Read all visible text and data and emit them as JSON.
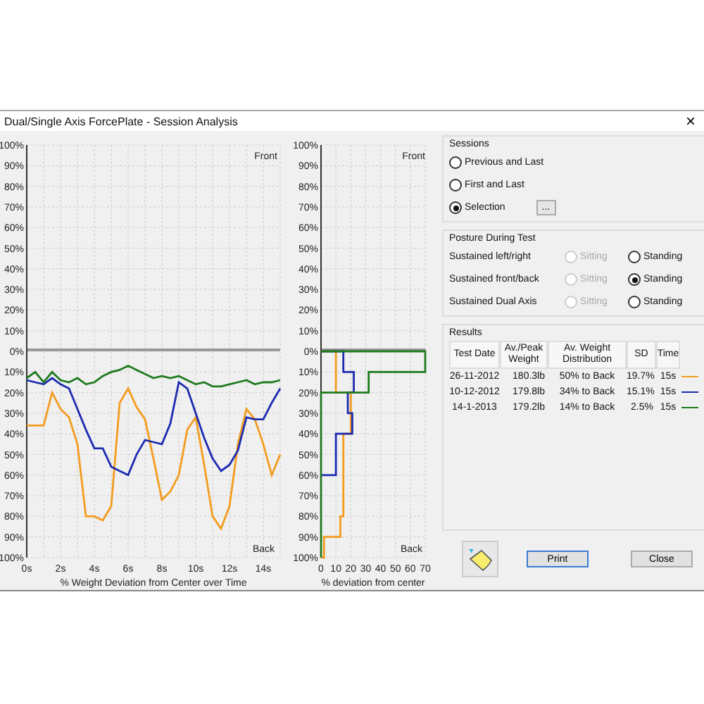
{
  "window": {
    "title": "Dual/Single Axis ForcePlate - Session Analysis",
    "close": "×"
  },
  "time_chart": {
    "top_label": "Front",
    "bottom_label": "Back",
    "chart_data": {
      "type": "line",
      "grid": true,
      "xlabel": "% Weight Deviation from Center over Time",
      "xlim": [
        0,
        15
      ],
      "ylim": [
        -100,
        100
      ],
      "x": [
        0,
        0.5,
        1,
        1.5,
        2,
        2.5,
        3,
        3.5,
        4,
        4.5,
        5,
        5.5,
        6,
        6.5,
        7,
        7.5,
        8,
        8.5,
        9,
        9.5,
        10,
        10.5,
        11,
        11.5,
        12,
        12.5,
        13,
        13.5,
        14,
        14.5,
        15
      ],
      "series": [
        {
          "color": "#f39c1f",
          "values": [
            -36,
            -36,
            -36,
            -20,
            -28,
            -32,
            -45,
            -80,
            -80,
            -82,
            -75,
            -25,
            -18,
            -27,
            -33,
            -52,
            -72,
            -68,
            -60,
            -38,
            -32,
            -55,
            -80,
            -86,
            -75,
            -45,
            -28,
            -33,
            -45,
            -60,
            -50
          ]
        },
        {
          "color": "#1c2bb0",
          "values": [
            -14,
            -15,
            -16,
            -13,
            -16,
            -18,
            -28,
            -38,
            -47,
            -47,
            -56,
            -58,
            -60,
            -50,
            -43,
            -44,
            -45,
            -35,
            -15,
            -18,
            -30,
            -42,
            -52,
            -58,
            -55,
            -48,
            -32,
            -33,
            -33,
            -25,
            -18
          ]
        },
        {
          "color": "#1f7a1f",
          "values": [
            -13,
            -10,
            -15,
            -10,
            -14,
            -15,
            -13,
            -16,
            -15,
            -12,
            -10,
            -9,
            -7,
            -9,
            -11,
            -13,
            -12,
            -13,
            -12,
            -14,
            -16,
            -15,
            -17,
            -17,
            -16,
            -15,
            -14,
            -16,
            -15,
            -15,
            -14
          ]
        }
      ],
      "xticks": [
        {
          "value": 0,
          "label": "0s"
        },
        {
          "value": 2,
          "label": "2s"
        },
        {
          "value": 4,
          "label": "4s"
        },
        {
          "value": 6,
          "label": "6s"
        },
        {
          "value": 8,
          "label": "8s"
        },
        {
          "value": 10,
          "label": "10s"
        },
        {
          "value": 12,
          "label": "12s"
        },
        {
          "value": 14,
          "label": "14s"
        }
      ],
      "yticks": [
        {
          "value": 100,
          "label": "100%"
        },
        {
          "value": 90,
          "label": "90%"
        },
        {
          "value": 80,
          "label": "80%"
        },
        {
          "value": 70,
          "label": "70%"
        },
        {
          "value": 60,
          "label": "60%"
        },
        {
          "value": 50,
          "label": "50%"
        },
        {
          "value": 40,
          "label": "40%"
        },
        {
          "value": 30,
          "label": "30%"
        },
        {
          "value": 20,
          "label": "20%"
        },
        {
          "value": 10,
          "label": "10%"
        },
        {
          "value": 0,
          "label": "0%"
        },
        {
          "value": -10,
          "label": "10%"
        },
        {
          "value": -20,
          "label": "20%"
        },
        {
          "value": -30,
          "label": "30%"
        },
        {
          "value": -40,
          "label": "40%"
        },
        {
          "value": -50,
          "label": "50%"
        },
        {
          "value": -60,
          "label": "60%"
        },
        {
          "value": -70,
          "label": "70%"
        },
        {
          "value": -80,
          "label": "80%"
        },
        {
          "value": -90,
          "label": "90%"
        },
        {
          "value": -100,
          "label": "100%"
        }
      ]
    }
  },
  "deviation_chart": {
    "top_label": "Front",
    "bottom_label": "Back",
    "chart_data": {
      "type": "line",
      "grid": true,
      "orientation": "horizontal",
      "xlabel": "% deviation from center",
      "xlim": [
        0,
        70
      ],
      "ylim": [
        -100,
        100
      ],
      "x": [
        0,
        0,
        -10,
        -10,
        -20,
        -20,
        -30,
        -30,
        -40,
        -40,
        -50,
        -50,
        -60,
        -60,
        -70,
        -70,
        -80,
        -80,
        -90,
        -90,
        -100,
        -100
      ],
      "series": [
        {
          "color": "#f39c1f",
          "values": [
            0,
            10,
            10,
            10,
            10,
            20,
            20,
            20,
            20,
            15,
            15,
            15,
            15,
            15,
            15,
            15,
            15,
            13,
            13,
            2,
            2,
            0
          ]
        },
        {
          "color": "#1c2bb0",
          "values": [
            0,
            15,
            15,
            22,
            22,
            18,
            18,
            21,
            21,
            10,
            10,
            10,
            10,
            0,
            null,
            null,
            null,
            null,
            null,
            null,
            null,
            null
          ]
        },
        {
          "color": "#1f7a1f",
          "values": [
            0,
            70,
            70,
            32,
            32,
            0,
            0,
            0,
            0,
            0,
            0,
            0,
            0,
            0,
            0,
            0,
            0,
            0,
            0,
            0,
            0,
            0
          ]
        }
      ],
      "xticks": [
        0,
        10,
        20,
        30,
        40,
        50,
        60,
        70
      ],
      "yticks": [
        {
          "value": 100,
          "label": "100%"
        },
        {
          "value": 90,
          "label": "90%"
        },
        {
          "value": 80,
          "label": "80%"
        },
        {
          "value": 70,
          "label": "70%"
        },
        {
          "value": 60,
          "label": "60%"
        },
        {
          "value": 50,
          "label": "50%"
        },
        {
          "value": 40,
          "label": "40%"
        },
        {
          "value": 30,
          "label": "30%"
        },
        {
          "value": 20,
          "label": "20%"
        },
        {
          "value": 10,
          "label": "10%"
        },
        {
          "value": 0,
          "label": "0%"
        },
        {
          "value": -10,
          "label": "10%"
        },
        {
          "value": -20,
          "label": "20%"
        },
        {
          "value": -30,
          "label": "30%"
        },
        {
          "value": -40,
          "label": "40%"
        },
        {
          "value": -50,
          "label": "50%"
        },
        {
          "value": -60,
          "label": "60%"
        },
        {
          "value": -70,
          "label": "70%"
        },
        {
          "value": -80,
          "label": "80%"
        },
        {
          "value": -90,
          "label": "90%"
        },
        {
          "value": -100,
          "label": "100%"
        }
      ]
    }
  },
  "sessions": {
    "title": "Sessions",
    "options": [
      {
        "label": "Previous and Last",
        "selected": false
      },
      {
        "label": "First and Last",
        "selected": false
      },
      {
        "label": "Selection",
        "selected": true
      }
    ],
    "browse_button": "..."
  },
  "posture": {
    "title": "Posture During Test",
    "rows": [
      {
        "label": "Sustained left/right",
        "sitting": {
          "label": "Sitting",
          "disabled": true,
          "selected": false
        },
        "standing": {
          "label": "Standing",
          "disabled": false,
          "selected": false
        }
      },
      {
        "label": "Sustained front/back",
        "sitting": {
          "label": "Sitting",
          "disabled": true,
          "selected": false
        },
        "standing": {
          "label": "Standing",
          "disabled": false,
          "selected": true
        }
      },
      {
        "label": "Sustained Dual Axis",
        "sitting": {
          "label": "Sitting",
          "disabled": true,
          "selected": false
        },
        "standing": {
          "label": "Standing",
          "disabled": false,
          "selected": false
        }
      }
    ]
  },
  "results": {
    "title": "Results",
    "columns": [
      "Test Date",
      "Av./Peak Weight",
      "Av. Weight Distribution",
      "SD",
      "Time"
    ],
    "rows": [
      {
        "date": "26-11-2012",
        "weight": "180.3lb",
        "distribution": "50% to Back",
        "sd": "19.7%",
        "time": "15s",
        "color": "#f39c1f"
      },
      {
        "date": "10-12-2012",
        "weight": "179.8lb",
        "distribution": "34% to Back",
        "sd": "15.1%",
        "time": "15s",
        "color": "#1c2bb0"
      },
      {
        "date": "14-1-2013",
        "weight": "179.2lb",
        "distribution": "14% to Back",
        "sd": "2.5%",
        "time": "15s",
        "color": "#1f7a1f"
      }
    ]
  },
  "buttons": [
    {
      "label": "Print",
      "focused": true
    },
    {
      "label": "Close",
      "focused": false
    }
  ]
}
